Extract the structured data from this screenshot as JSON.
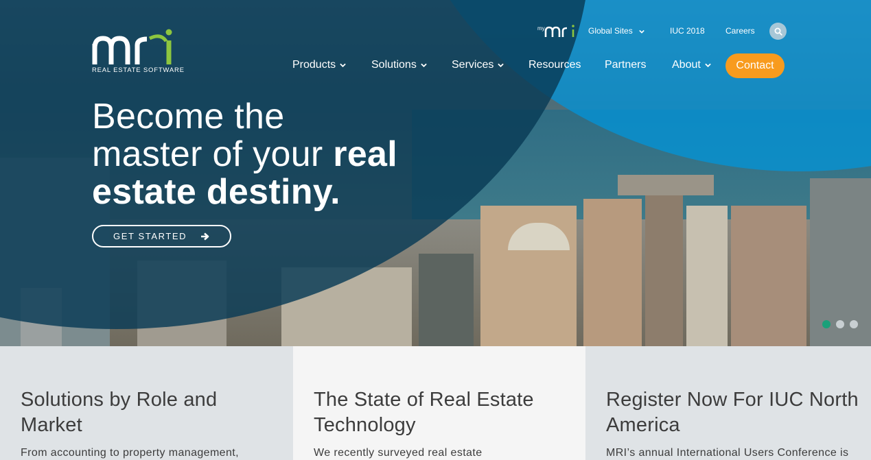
{
  "brand": {
    "logo_text": "mri",
    "tagline": "REAL ESTATE SOFTWARE"
  },
  "utility_nav": {
    "mymri_label": "mymri",
    "global_sites": "Global Sites",
    "iuc": "IUC 2018",
    "careers": "Careers",
    "search_icon": "search-icon"
  },
  "main_nav": {
    "products": "Products",
    "solutions": "Solutions",
    "services": "Services",
    "resources": "Resources",
    "partners": "Partners",
    "about": "About",
    "contact": "Contact"
  },
  "hero": {
    "line1": "Become the",
    "line2_light": "master of your ",
    "line2_bold": "real",
    "line3_bold": "estate destiny.",
    "cta_label": "GET STARTED",
    "carousel": {
      "slides": 3,
      "active": 1
    }
  },
  "cards": [
    {
      "title": "Solutions by Role and Market",
      "body": "From accounting to property management,"
    },
    {
      "title": "The State of Real Estate Technology",
      "body": "We recently surveyed real estate"
    },
    {
      "title": "Register Now For IUC North America",
      "body": "MRI’s annual International Users Conference is"
    }
  ],
  "colors": {
    "accent_orange": "#f89b1e",
    "brand_green": "#8dc63f",
    "overlay_navy": "#083a56",
    "overlay_blue": "#0096dc",
    "dot_active": "#1aa079",
    "card1_bg": "#dfe3e6",
    "card2_bg": "#f5f5f5",
    "card3_bg": "#dfe3e6"
  }
}
